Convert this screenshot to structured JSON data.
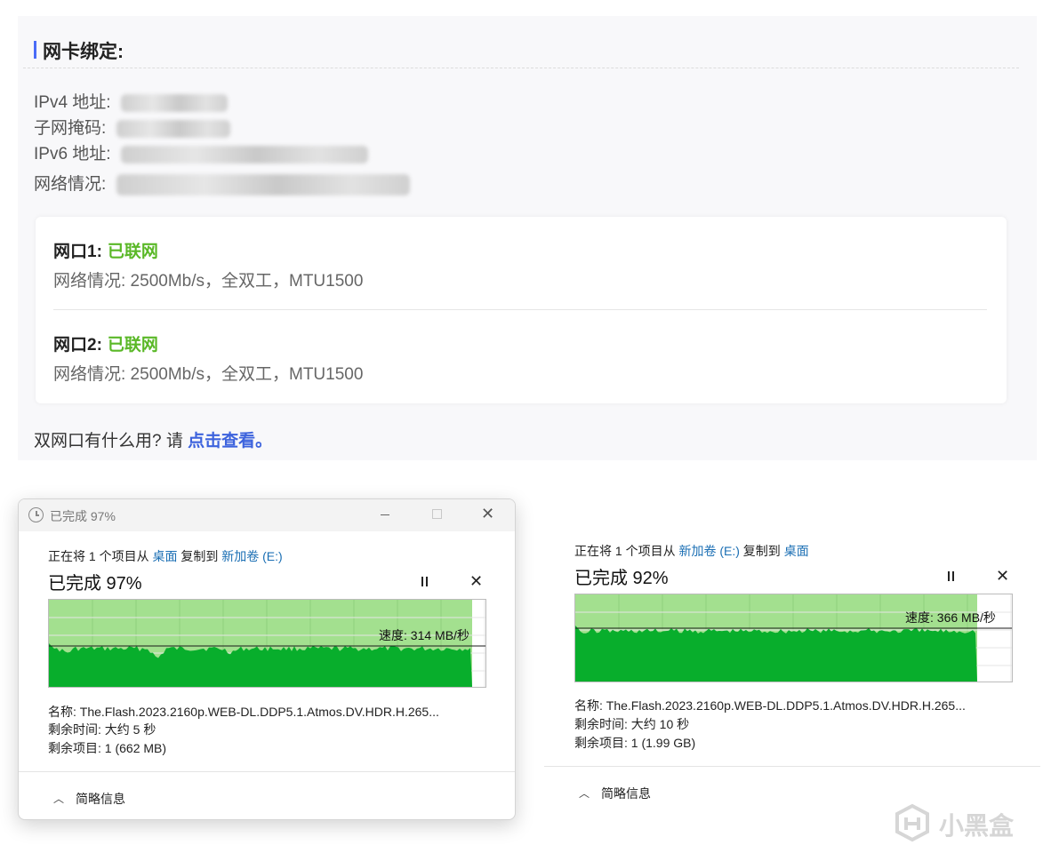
{
  "network": {
    "title": "网卡绑定:",
    "rows": [
      {
        "label": "IPv4 地址:"
      },
      {
        "label": "子网掩码:"
      },
      {
        "label": "IPv6 地址:"
      },
      {
        "label": "网络情况:"
      }
    ],
    "ports": [
      {
        "name": "网口1:",
        "status": "已联网",
        "detail": "网络情况:  2500Mb/s，全双工，MTU1500"
      },
      {
        "name": "网口2:",
        "status": "已联网",
        "detail": "网络情况:  2500Mb/s，全双工，MTU1500"
      }
    ],
    "help_text": "双网口有什么用? 请 ",
    "help_link": "点击查看。",
    "status_color": "#5ab827",
    "link_color": "#3d63dd"
  },
  "dialog_left": {
    "window_title": "已完成 97%",
    "copy_prefix": "正在将 1 个项目从 ",
    "source": "桌面",
    "copy_mid": " 复制到 ",
    "dest": "新加卷 (E:)",
    "percent_text": "已完成 97%",
    "progress": 0.97,
    "speed": "速度: 314 MB/秒",
    "name": "名称: The.Flash.2023.2160p.WEB-DL.DDP5.1.Atmos.DV.HDR.H.265...",
    "time_left": "剩余时间: 大约 5 秒",
    "items_left": "剩余项目: 1 (662 MB)",
    "details_toggle": "简略信息"
  },
  "dialog_right": {
    "copy_prefix": "正在将 1 个项目从 ",
    "source": "新加卷 (E:)",
    "copy_mid": " 复制到 ",
    "dest": "桌面",
    "percent_text": "已完成 92%",
    "progress": 0.92,
    "speed": "速度: 366 MB/秒",
    "name": "名称: The.Flash.2023.2160p.WEB-DL.DDP5.1.Atmos.DV.HDR.H.265...",
    "time_left": "剩余时间: 大约 10 秒",
    "items_left": "剩余项目: 1 (1.99 GB)",
    "details_toggle": "简略信息"
  },
  "watermark": "小黑盒",
  "colors": {
    "graph_fill": "#08ae2c",
    "graph_bg": "#a3e08f",
    "accent_bar": "#4a6cf7"
  }
}
